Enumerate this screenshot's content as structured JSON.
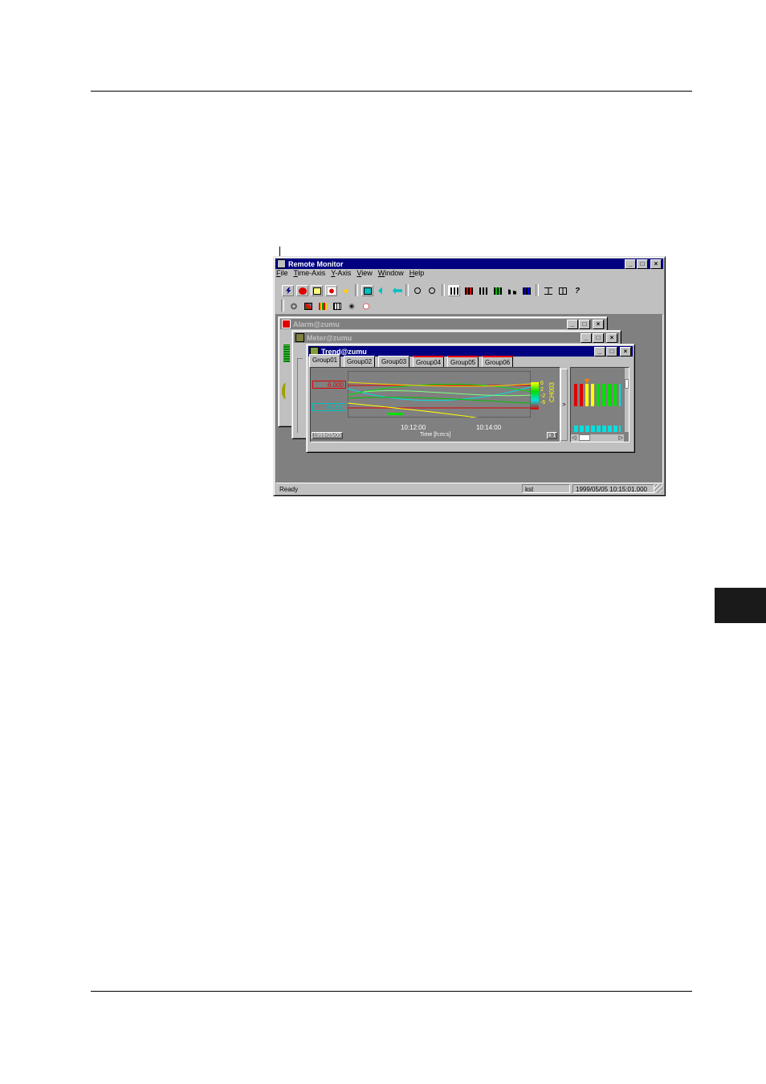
{
  "main_window": {
    "title": "Remote Monitor",
    "menus": [
      "File",
      "Time-Axis",
      "Y-Axis",
      "View",
      "Window",
      "Help"
    ]
  },
  "toolbar_row1": [
    "connect-icon",
    "stop-icon",
    "record-icon",
    "alarm-icon",
    "flash-icon",
    "scroll-right-icon",
    "scroll-left-icon",
    "fast-scroll-icon",
    "zoom-in-icon",
    "zoom-out-icon",
    "bar-display-icon",
    "bar-red-icon",
    "bar-green-icon",
    "bar-multi-icon",
    "bar-step-icon",
    "bar-mixed-icon",
    "bracket-icon",
    "fit-icon",
    "help-icon"
  ],
  "toolbar_row2": [
    "gear-icon",
    "trend-icon",
    "bars-icon",
    "table-icon",
    "meter-icon",
    "clock-icon"
  ],
  "windows": {
    "alarm": {
      "title": "Alarm@zumu"
    },
    "meter": {
      "title": "Meter@zumu"
    },
    "trend": {
      "title": "Trend@zumu",
      "tabs": [
        {
          "label": "Group01",
          "alarm": false
        },
        {
          "label": "Group02",
          "alarm": false
        },
        {
          "label": "Group03",
          "alarm": false
        },
        {
          "label": "Group04",
          "alarm": true
        },
        {
          "label": "Group05",
          "alarm": true
        },
        {
          "label": "Group06",
          "alarm": true
        }
      ],
      "upper_value": "6.000",
      "lower_value": "-6.000",
      "time_ticks": [
        "10:12:00",
        "10:14:00"
      ],
      "time_label": "Time [h:m:s]",
      "date": "1999/05/05",
      "zoom": "x 1",
      "scale_values": [
        "6",
        "2",
        "-2",
        "-6"
      ],
      "channel_label": "CH003",
      "arrow_label": ">"
    }
  },
  "status_bar": {
    "ready": "Ready",
    "zone": "kst",
    "datetime": "1999/05/05 10:15:01.000"
  },
  "colors": {
    "titlebar_active": "#000080",
    "titlebar_inactive": "#808080",
    "face": "#c0c0c0",
    "plot_bg": "#808080"
  }
}
